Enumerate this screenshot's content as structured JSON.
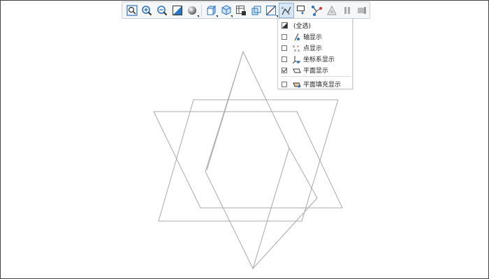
{
  "toolbar": {
    "buttons": [
      {
        "name": "zoom-fit-icon"
      },
      {
        "name": "zoom-in-icon"
      },
      {
        "name": "zoom-out-icon"
      },
      {
        "name": "display-mode-icon"
      },
      {
        "name": "shading-sphere-icon"
      },
      {
        "name": "view-cube-icon"
      },
      {
        "name": "iso-view-icon"
      },
      {
        "name": "section-view-icon"
      },
      {
        "name": "wireframe-box-icon"
      },
      {
        "name": "measure-line-icon"
      },
      {
        "name": "filter-display-icon"
      },
      {
        "name": "datum-display-icon"
      },
      {
        "name": "node-link-icon"
      },
      {
        "name": "triangle-mesh-icon"
      },
      {
        "name": "pause-icon"
      },
      {
        "name": "end-icon"
      }
    ]
  },
  "menu": {
    "select_all": "(全选)",
    "items": [
      {
        "label": "轴显示",
        "checked": false,
        "icon": "axis-icon"
      },
      {
        "label": "点显示",
        "checked": false,
        "icon": "point-icon"
      },
      {
        "label": "坐标系显示",
        "checked": false,
        "icon": "csys-icon"
      },
      {
        "label": "平面显示",
        "checked": true,
        "icon": "plane-icon"
      },
      {
        "label": "平面填充显示",
        "checked": false,
        "icon": "plane-fill-icon"
      }
    ]
  },
  "colors": {
    "geometry_stroke": "#a8a8a8",
    "toolbar_bg": "#f4f6f8",
    "active_bg": "#d6e6f5",
    "icon_blue": "#2a74c4"
  }
}
